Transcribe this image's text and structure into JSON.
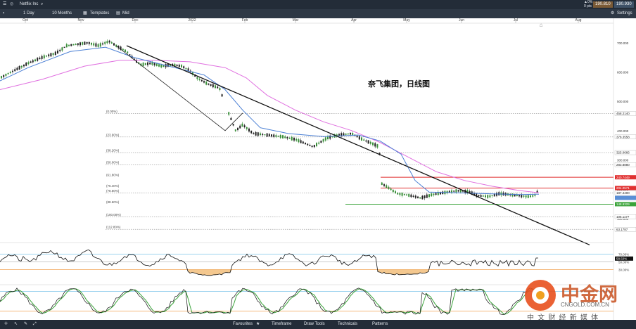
{
  "topbar": {
    "symbol": "Netflix Inc",
    "change": "▲0%",
    "change_sub": "0 pts",
    "bid": "190.810",
    "ask": "190.930"
  },
  "toolbar": {
    "interval": "1 Day",
    "range": "10 Months",
    "templates": "Templates",
    "price_type": "Mid",
    "settings": "Settings"
  },
  "bottom_bar": {
    "favourites": "Favourites",
    "timeframe": "Timeframe",
    "draw_tools": "Draw Tools",
    "technicals": "Technicals",
    "patterns": "Patterns"
  },
  "annotation": "奈飞集团，日线图",
  "colors": {
    "up": "#3a8f3a",
    "down": "#222222",
    "ma_fast": "#4a7fd4",
    "ma_slow": "#e070e0",
    "red_line": "#e03030",
    "green_line": "#3aa33a",
    "rsi_fill": "#f0b060"
  },
  "watermark": {
    "brand": "中金网",
    "url": "CNGOLD.COM.CN",
    "tagline": "中 文 财 经 新 媒 体"
  },
  "chart_data": {
    "type": "candlestick",
    "x_months": [
      "Oct",
      "Nov",
      "Dec",
      "2022",
      "Feb",
      "Mar",
      "Apr",
      "May",
      "Jun",
      "Jul",
      "Aug"
    ],
    "y_ticks": [
      "700.000",
      "600.000",
      "500.000",
      "400.000",
      "300.000",
      "200.000",
      "100.000"
    ],
    "fib_levels": [
      {
        "pct": "(0.00%)",
        "price": "458.2140"
      },
      {
        "pct": "(23.60%)",
        "price": "378.3558"
      },
      {
        "pct": "(38.20%)",
        "price": "325.0666"
      },
      {
        "pct": "(50.00%)",
        "price": "283.8880"
      },
      {
        "pct": "(61.80%)",
        "price": "240.7449"
      },
      {
        "pct": "(76.40%)",
        "price": "204.0571"
      },
      {
        "pct": "(78.60%)",
        "price": "187.4400"
      },
      {
        "pct": "(88.60%)",
        "price": "148.9329"
      },
      {
        "pct": "(100.00%)",
        "price": "106.1177"
      },
      {
        "pct": "(112.80%)",
        "price": "63.1787"
      }
    ],
    "trendline_from": {
      "date": "Oct 2021 end",
      "price": 690
    },
    "trendline_to": {
      "date": "Aug 2022",
      "price": 120
    },
    "indicator1": {
      "name": "RSI",
      "value": "58.50%",
      "ticks": [
        "70.00%",
        "50.00%",
        "30.00%"
      ]
    },
    "indicator2": {
      "name": "Stochastic"
    }
  }
}
